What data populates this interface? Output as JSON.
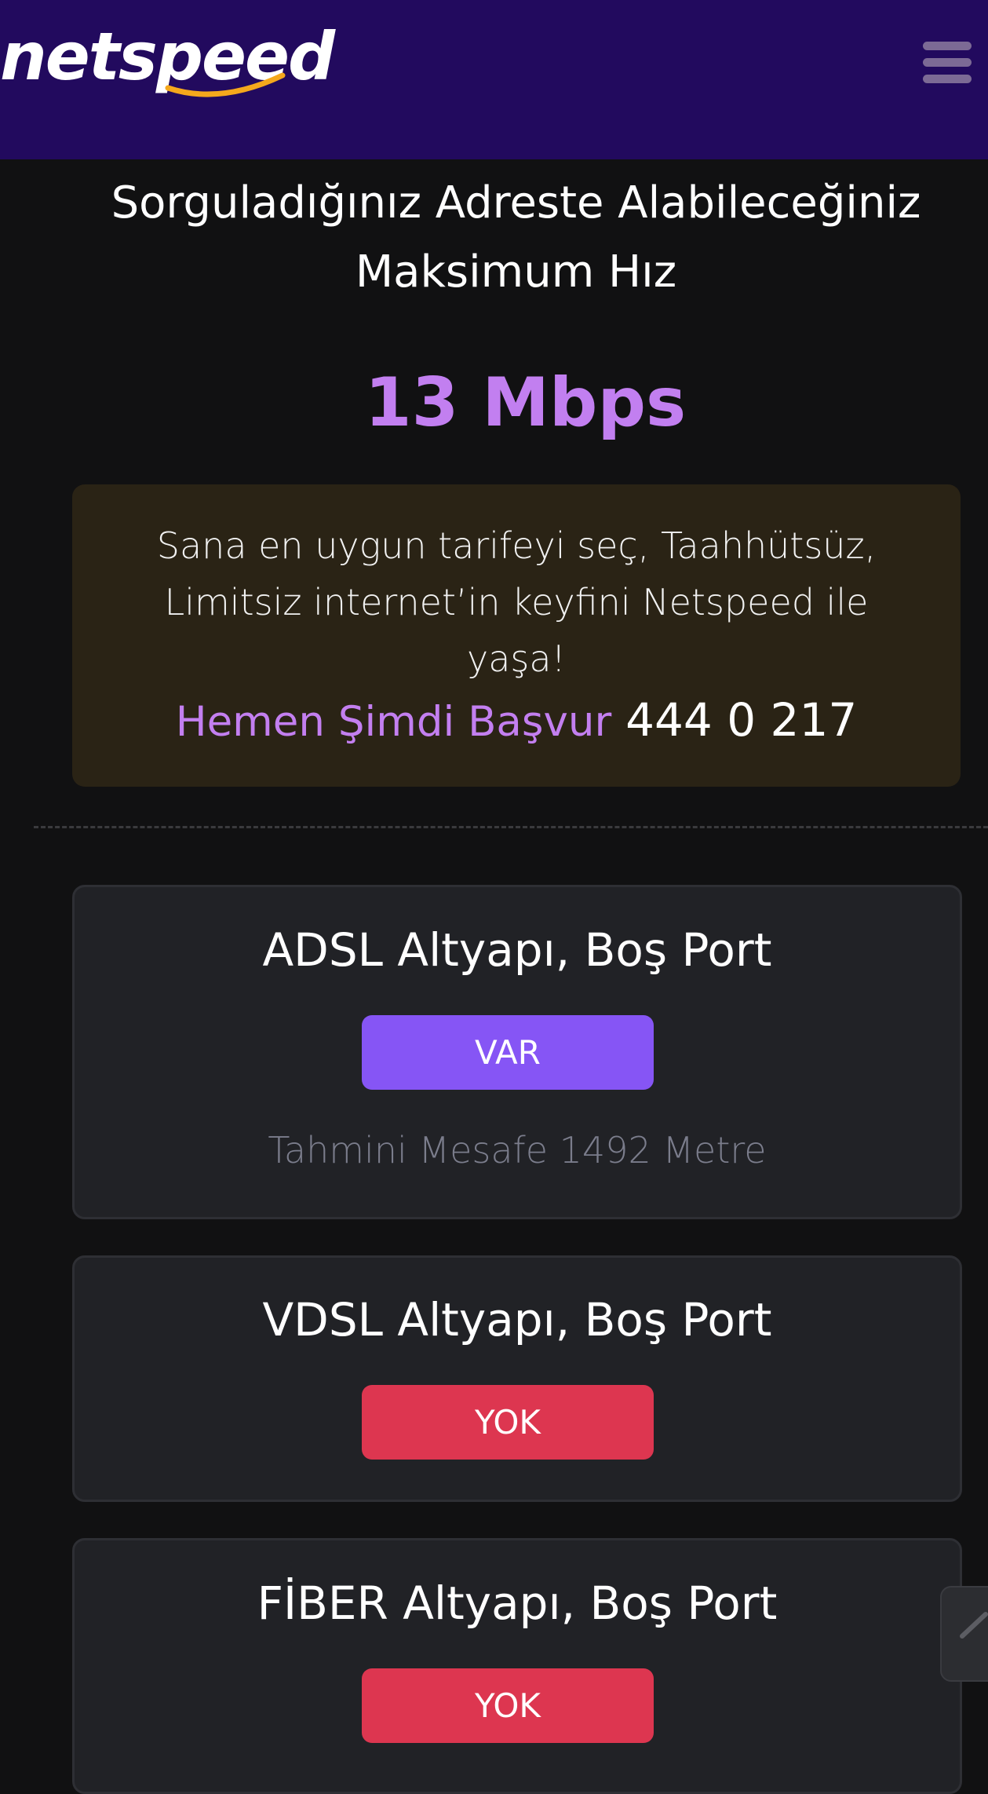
{
  "header": {
    "logo_text": "netspeed",
    "colors": {
      "background": "#220a5e",
      "swoosh": "#f5a81c"
    },
    "menu_icon": "hamburger-icon"
  },
  "result": {
    "title": "Sorguladığınız Adreste Alabileceğiniz Maksimum Hız",
    "speed": "13 Mbps"
  },
  "promo": {
    "text": "Sana en uygun tarifeyi seç, Taahhütsüz, Limitsiz internet’in keyfini Netspeed ile yaşa!",
    "cta_label": "Hemen Şimdi Başvur",
    "phone": "444 0 217"
  },
  "infrastructure": [
    {
      "title": "ADSL Altyapı, Boş Port",
      "status": "VAR",
      "distance": "Tahmini Mesafe 1492 Metre"
    },
    {
      "title": "VDSL Altyapı, Boş Port",
      "status": "YOK"
    },
    {
      "title": "FİBER Altyapı, Boş Port",
      "status": "YOK"
    }
  ],
  "colors": {
    "accent": "#c27ff0",
    "status_yes": "#8655f5",
    "status_no": "#dd3650"
  },
  "scroll_top_icon": "chevron-up-icon"
}
